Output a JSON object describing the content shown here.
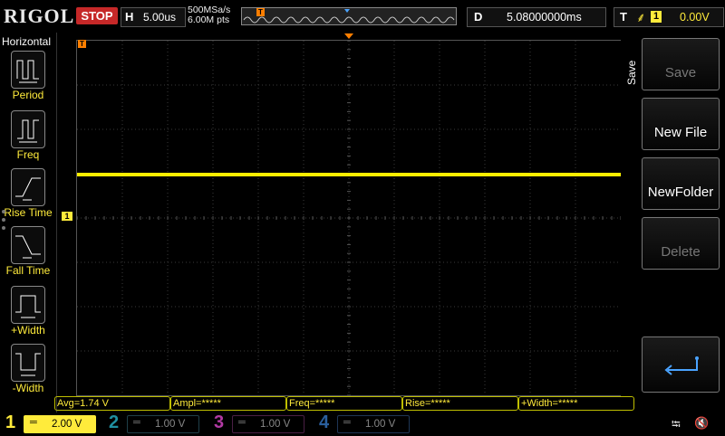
{
  "top": {
    "logo": "RIGOL",
    "run_state": "STOP",
    "horizontal_key": "H",
    "timebase": "5.00us",
    "sample_rate": "500MSa/s",
    "memory_depth": "6.00M pts",
    "delay_key": "D",
    "delay_value": "5.08000000ms",
    "trigger_key": "T",
    "trigger_source": "1",
    "trigger_level": "0.00V"
  },
  "left_panel": {
    "title": "Horizontal",
    "items": [
      {
        "label": "Period",
        "icon": "period-icon"
      },
      {
        "label": "Freq",
        "icon": "freq-icon"
      },
      {
        "label": "Rise Time",
        "icon": "rise-time-icon"
      },
      {
        "label": "Fall Time",
        "icon": "fall-time-icon"
      },
      {
        "label": "+Width",
        "icon": "pos-width-icon"
      },
      {
        "label": "-Width",
        "icon": "neg-width-icon"
      }
    ]
  },
  "right_panel": {
    "title": "Save",
    "buttons": [
      {
        "label": "Save",
        "enabled": false
      },
      {
        "label": "New File",
        "enabled": true
      },
      {
        "label": "NewFolder",
        "enabled": true
      },
      {
        "label": "Delete",
        "enabled": false
      }
    ],
    "enter_icon": "enter-arrow-icon"
  },
  "markers": {
    "left_trigger_marker": "T",
    "channel_marker": "1",
    "right_trigger_marker": "T",
    "memory_marker": "T"
  },
  "measurements": [
    {
      "text": "Avg=1.74 V"
    },
    {
      "text": "Ampl=*****"
    },
    {
      "text": "Freq=*****"
    },
    {
      "text": "Rise=*****"
    },
    {
      "text": "+Width=*****"
    }
  ],
  "channels": [
    {
      "num": "1",
      "scale": "2.00 V",
      "color": "#ffeb3b",
      "active": true
    },
    {
      "num": "2",
      "scale": "1.00 V",
      "color": "#1f8fa0",
      "active": false
    },
    {
      "num": "3",
      "scale": "1.00 V",
      "color": "#b23aa4",
      "active": false
    },
    {
      "num": "4",
      "scale": "1.00 V",
      "color": "#2a5f9e",
      "active": false
    }
  ],
  "status_icons": [
    "usb-icon",
    "speaker-muted-icon"
  ],
  "colors": {
    "ch1": "#ffeb3b",
    "accent_red": "#c62828",
    "trace": "#ffee00"
  }
}
